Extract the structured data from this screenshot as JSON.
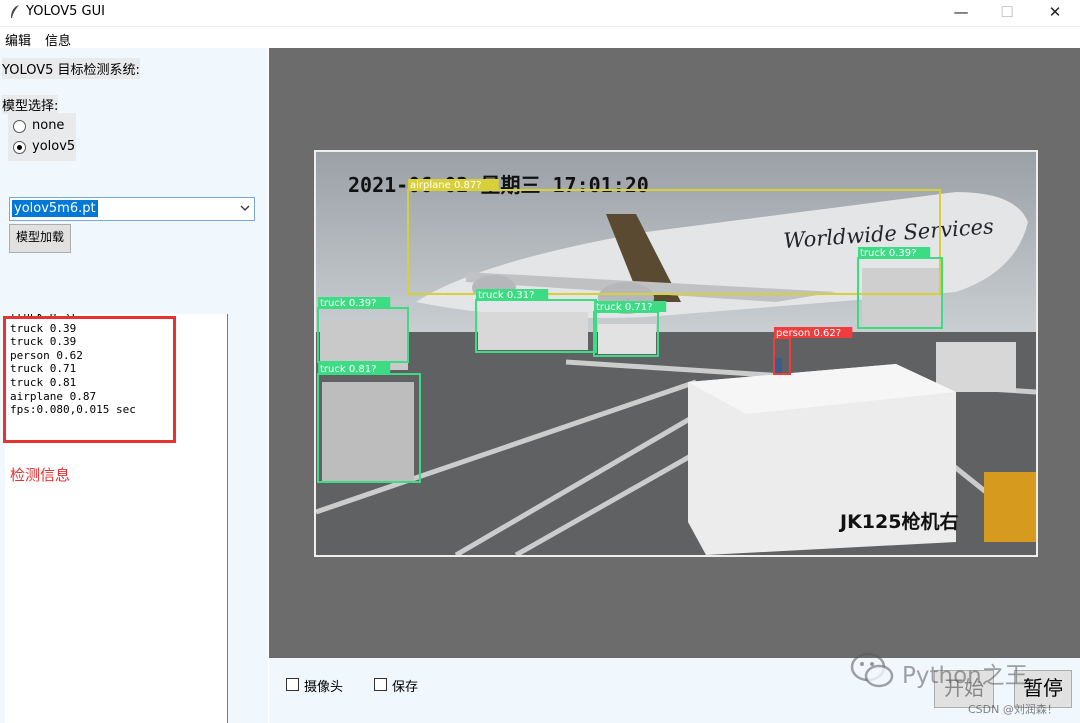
{
  "window": {
    "title": "YOLOV5 GUI",
    "icon": "feather-icon",
    "controls": {
      "minimize": "—",
      "maximize": "☐",
      "close": "✕"
    }
  },
  "menu": {
    "items": [
      "编辑",
      "信息"
    ]
  },
  "sidebar": {
    "system_title": "YOLOV5 目标检测系统:",
    "model_select_label": "模型选择:",
    "radios": [
      {
        "label": "none",
        "checked": false
      },
      {
        "label": "yolov5",
        "checked": true
      }
    ],
    "model_dropdown": {
      "value": "yolov5m6.pt"
    },
    "load_button": "模型加载",
    "detection_lines": [
      "truck 0.31",
      "truck 0.39",
      "truck 0.39",
      "person 0.62",
      "truck 0.71",
      "truck 0.81",
      "airplane 0.87",
      "fps:0.080,0.015 sec"
    ],
    "detection_caption": "检测信息"
  },
  "controls": {
    "camera_label": "摄像头",
    "save_label": "保存",
    "start_button": "开始",
    "pause_button": "暂停"
  },
  "camera": {
    "timestamp": "2021-06-02  星期三  17:01:20",
    "aircraft_text": "Worldwide Services",
    "location_text": "JK125枪机右",
    "detections": [
      {
        "label": "airplane 0.87?",
        "color": "#d8d03a"
      },
      {
        "label": "truck 0.39?",
        "color": "#3ddb84"
      },
      {
        "label": "truck 0.31?",
        "color": "#3ddb84"
      },
      {
        "label": "truck 0.71?",
        "color": "#3ddb84"
      },
      {
        "label": "truck 0.39?",
        "color": "#3ddb84"
      },
      {
        "label": "truck 0.81?",
        "color": "#3ddb84"
      },
      {
        "label": "person 0.62?",
        "color": "#f03c3c"
      }
    ]
  },
  "watermark": {
    "text": "Python之王",
    "csdn": "CSDN @刘润森！"
  },
  "colors": {
    "annotation_red": "#e63232",
    "panel_bg": "#f0f7fd",
    "image_bg": "#6c6c6c"
  }
}
